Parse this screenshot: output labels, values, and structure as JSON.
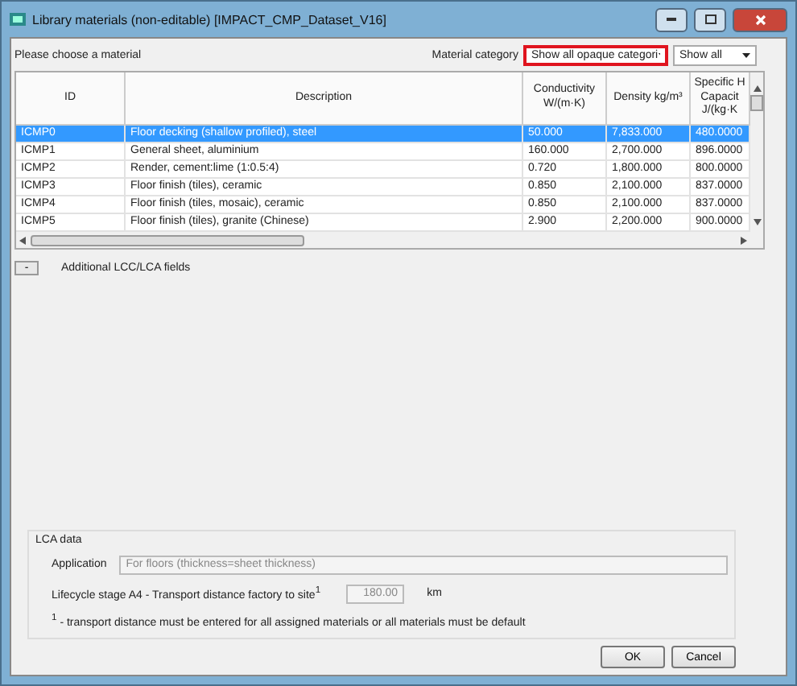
{
  "window": {
    "title": "Library materials (non-editable) [IMPACT_CMP_Dataset_V16]"
  },
  "header": {
    "prompt": "Please choose a material",
    "category_label": "Material category",
    "category_dropdown": {
      "value": "Show all opaque categori",
      "highlighted": true
    },
    "filter_dropdown": {
      "value": "Show all",
      "highlighted": false
    }
  },
  "table": {
    "columns": [
      {
        "lines": [
          "ID"
        ]
      },
      {
        "lines": [
          "Description"
        ]
      },
      {
        "lines": [
          "Conductivity",
          "W/(m·K)"
        ]
      },
      {
        "lines": [
          "Density kg/m³"
        ]
      },
      {
        "lines": [
          "Specific H",
          "Capacit",
          "J/(kg·K"
        ]
      }
    ],
    "rows": [
      {
        "selected": true,
        "cells": [
          "ICMP0",
          "Floor decking (shallow profiled), steel",
          "50.000",
          "7,833.000",
          "480.0000"
        ]
      },
      {
        "selected": false,
        "cells": [
          "ICMP1",
          "General sheet, aluminium",
          "160.000",
          "2,700.000",
          "896.0000"
        ]
      },
      {
        "selected": false,
        "cells": [
          "ICMP2",
          "Render, cement:lime (1:0.5:4)",
          "0.720",
          "1,800.000",
          "800.0000"
        ]
      },
      {
        "selected": false,
        "cells": [
          "ICMP3",
          "Floor finish (tiles), ceramic",
          "0.850",
          "2,100.000",
          "837.0000"
        ]
      },
      {
        "selected": false,
        "cells": [
          "ICMP4",
          "Floor finish (tiles, mosaic), ceramic",
          "0.850",
          "2,100.000",
          "837.0000"
        ]
      },
      {
        "selected": false,
        "cells": [
          "ICMP5",
          "Floor finish (tiles), granite (Chinese)",
          "2.900",
          "2,200.000",
          "900.0000"
        ]
      }
    ]
  },
  "expander": {
    "button": "-",
    "label": "Additional LCC/LCA fields",
    "expanded": true
  },
  "lca": {
    "title": "LCA data",
    "application_label": "Application",
    "application_value": "For floors (thickness=sheet thickness)",
    "distance_label": "Lifecycle stage A4 - Transport distance factory to site$^{1}$",
    "distance_value": "180.00",
    "distance_unit": "km",
    "footnote": "$^{1}$ - transport distance must be entered for all assigned materials or all materials must be default"
  },
  "buttons": [
    "OK",
    "Cancel"
  ]
}
